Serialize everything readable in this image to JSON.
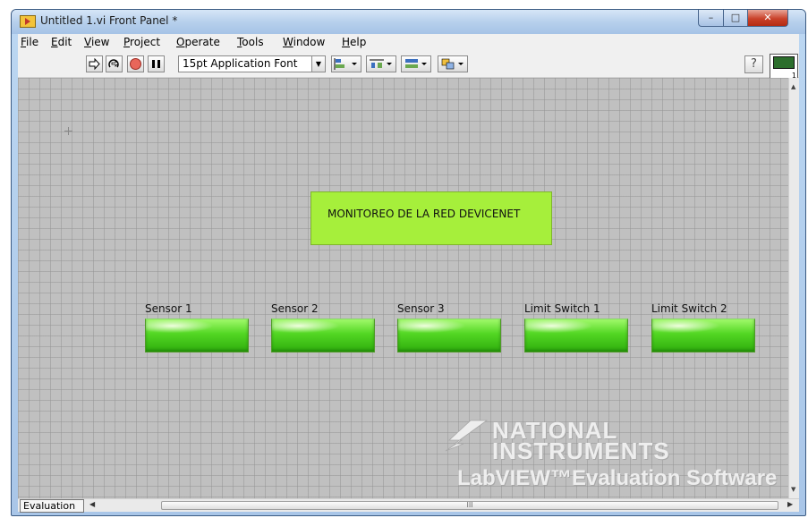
{
  "window": {
    "title": "Untitled 1.vi Front Panel *",
    "controls": {
      "minimize": "–",
      "maximize": "□",
      "close": "✕"
    }
  },
  "menu": {
    "items": [
      {
        "pre": "",
        "key": "F",
        "rest": "ile"
      },
      {
        "pre": "",
        "key": "E",
        "rest": "dit"
      },
      {
        "pre": "",
        "key": "V",
        "rest": "iew"
      },
      {
        "pre": "",
        "key": "P",
        "rest": "roject"
      },
      {
        "pre": "",
        "key": "O",
        "rest": "perate"
      },
      {
        "pre": "",
        "key": "T",
        "rest": "ools"
      },
      {
        "pre": "",
        "key": "W",
        "rest": "indow"
      },
      {
        "pre": "",
        "key": "H",
        "rest": "elp"
      }
    ]
  },
  "toolbar": {
    "font": "15pt Application Font",
    "help": "?",
    "connector_pane_number": "1"
  },
  "panel": {
    "title": "MONITOREO DE LA RED DEVICENET",
    "indicators": [
      {
        "label": "Sensor 1"
      },
      {
        "label": "Sensor 2"
      },
      {
        "label": "Sensor  3"
      },
      {
        "label": "Limit Switch 1"
      },
      {
        "label": "Limit Switch 2"
      }
    ],
    "indicator_color": "#4fd81f",
    "background_color": "#c0c0c0"
  },
  "watermark": {
    "line1": "NATIONAL",
    "line2": "INSTRUMENTS",
    "line3": "LabVIEW™Evaluation Software"
  },
  "statusbar": {
    "tab": "Evaluation",
    "scroll_grip": "III"
  }
}
